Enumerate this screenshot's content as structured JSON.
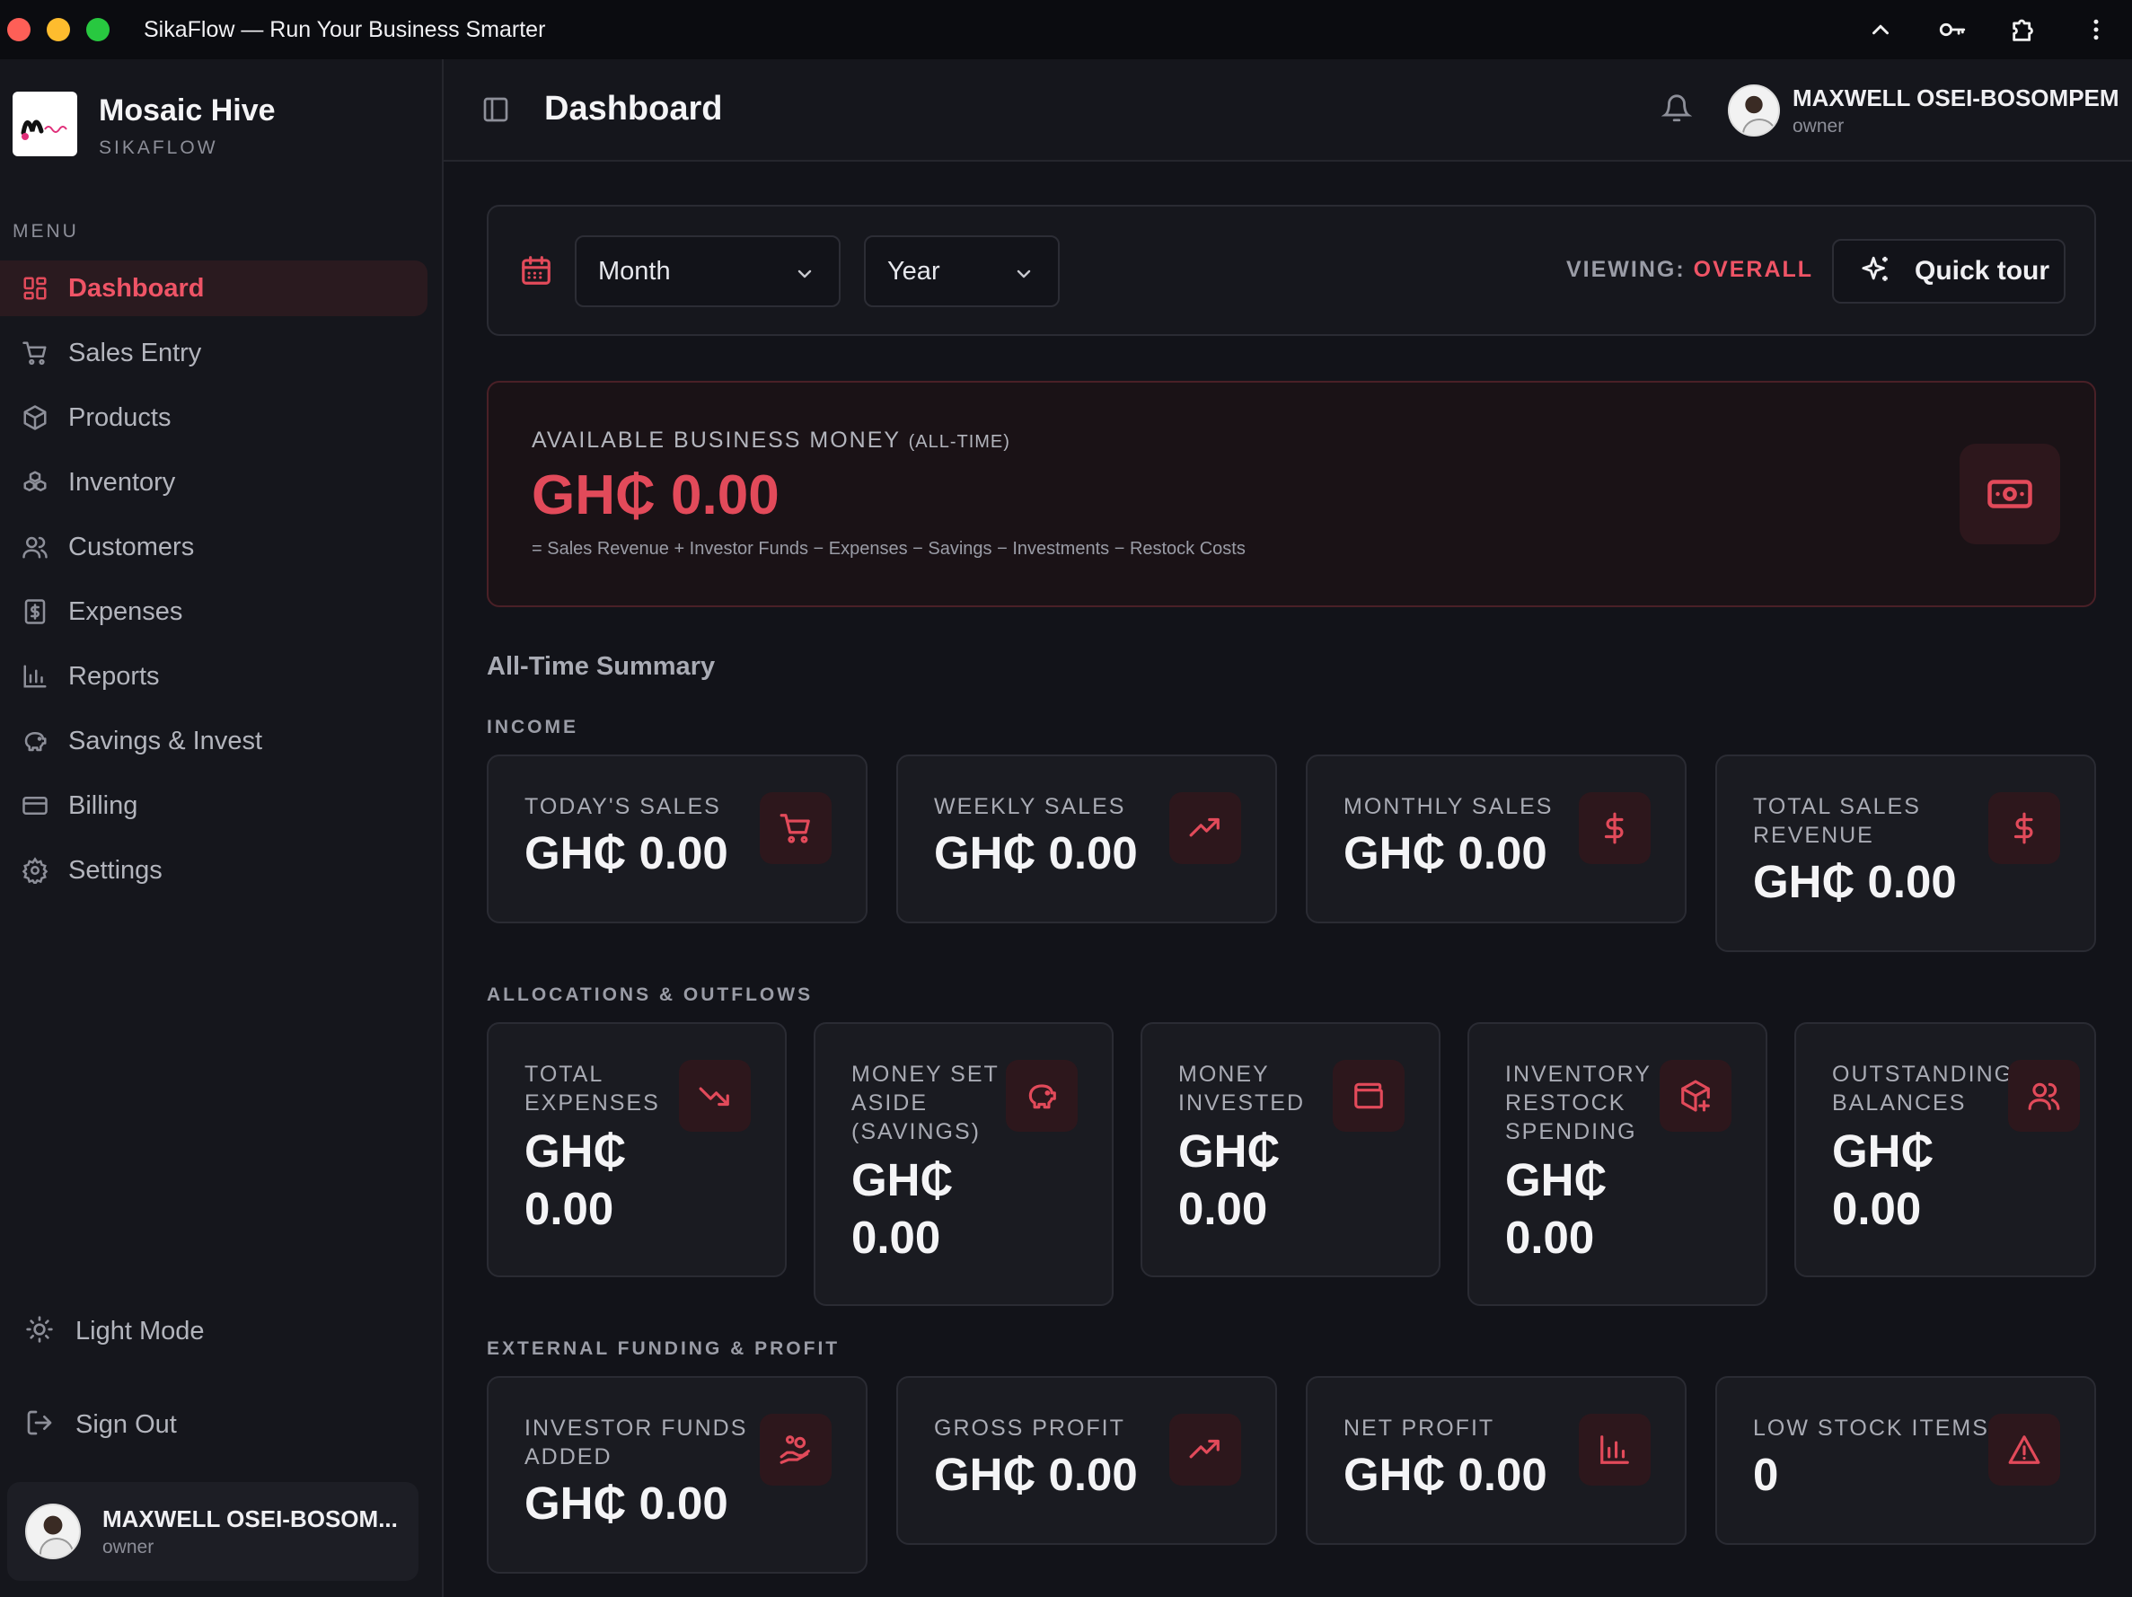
{
  "window": {
    "title": "SikaFlow — Run Your Business Smarter"
  },
  "sidebar": {
    "brand_name": "Mosaic Hive",
    "brand_sub": "SIKAFLOW",
    "menu_label": "MENU",
    "items": [
      {
        "label": "Dashboard",
        "icon": "grid-icon",
        "active": true
      },
      {
        "label": "Sales Entry",
        "icon": "cart-icon"
      },
      {
        "label": "Products",
        "icon": "box-icon"
      },
      {
        "label": "Inventory",
        "icon": "boxes-icon"
      },
      {
        "label": "Customers",
        "icon": "users-icon"
      },
      {
        "label": "Expenses",
        "icon": "receipt-icon"
      },
      {
        "label": "Reports",
        "icon": "bar-chart-icon"
      },
      {
        "label": "Savings & Invest",
        "icon": "piggy-bank-icon"
      },
      {
        "label": "Billing",
        "icon": "credit-card-icon"
      },
      {
        "label": "Settings",
        "icon": "gear-icon"
      }
    ],
    "light_mode_label": "Light Mode",
    "sign_out_label": "Sign Out",
    "user": {
      "name": "MAXWELL OSEI-BOSOM...",
      "role": "owner"
    }
  },
  "header": {
    "page_title": "Dashboard",
    "user": {
      "name": "MAXWELL OSEI-BOSOMPEM",
      "role": "owner"
    }
  },
  "filters": {
    "period_select": "Month",
    "year_select": "Year",
    "viewing_label": "VIEWING:",
    "viewing_value": "OVERALL",
    "quick_tour_label": "Quick tour"
  },
  "available_money": {
    "label": "AVAILABLE BUSINESS MONEY",
    "label_suffix": "(ALL-TIME)",
    "value": "GH₵ 0.00",
    "formula": "= Sales Revenue + Investor Funds − Expenses − Savings − Investments − Restock Costs"
  },
  "summary": {
    "title": "All-Time Summary",
    "income_label": "INCOME",
    "income": [
      {
        "label": "TODAY'S SALES",
        "value": "GH₵ 0.00",
        "icon": "cart-icon"
      },
      {
        "label": "WEEKLY SALES",
        "value": "GH₵ 0.00",
        "icon": "trending-up-icon"
      },
      {
        "label": "MONTHLY SALES",
        "value": "GH₵ 0.00",
        "icon": "dollar-icon"
      },
      {
        "label": "TOTAL SALES REVENUE",
        "value": "GH₵ 0.00",
        "icon": "dollar-icon"
      }
    ],
    "allocations_label": "ALLOCATIONS & OUTFLOWS",
    "allocations": [
      {
        "label": "TOTAL EXPENSES",
        "value": "GH₵ 0.00",
        "icon": "trending-down-icon"
      },
      {
        "label": "MONEY SET ASIDE (SAVINGS)",
        "value": "GH₵ 0.00",
        "icon": "piggy-bank-icon"
      },
      {
        "label": "MONEY INVESTED",
        "value": "GH₵ 0.00",
        "icon": "wallet-icon"
      },
      {
        "label": "INVENTORY RESTOCK SPENDING",
        "value": "GH₵ 0.00",
        "icon": "package-plus-icon"
      },
      {
        "label": "OUTSTANDING BALANCES",
        "value": "GH₵ 0.00",
        "icon": "users-icon"
      }
    ],
    "funding_label": "EXTERNAL FUNDING & PROFIT",
    "funding": [
      {
        "label": "INVESTOR FUNDS ADDED",
        "value": "GH₵ 0.00",
        "icon": "hand-coins-icon"
      },
      {
        "label": "GROSS PROFIT",
        "value": "GH₵ 0.00",
        "icon": "trending-up-icon"
      },
      {
        "label": "NET PROFIT",
        "value": "GH₵ 0.00",
        "icon": "bar-chart-icon"
      },
      {
        "label": "LOW STOCK ITEMS",
        "value": "0",
        "icon": "alert-triangle-icon"
      }
    ]
  },
  "colors": {
    "accent": "#e24a5a",
    "background": "#121319",
    "card": "#1a1b21"
  }
}
